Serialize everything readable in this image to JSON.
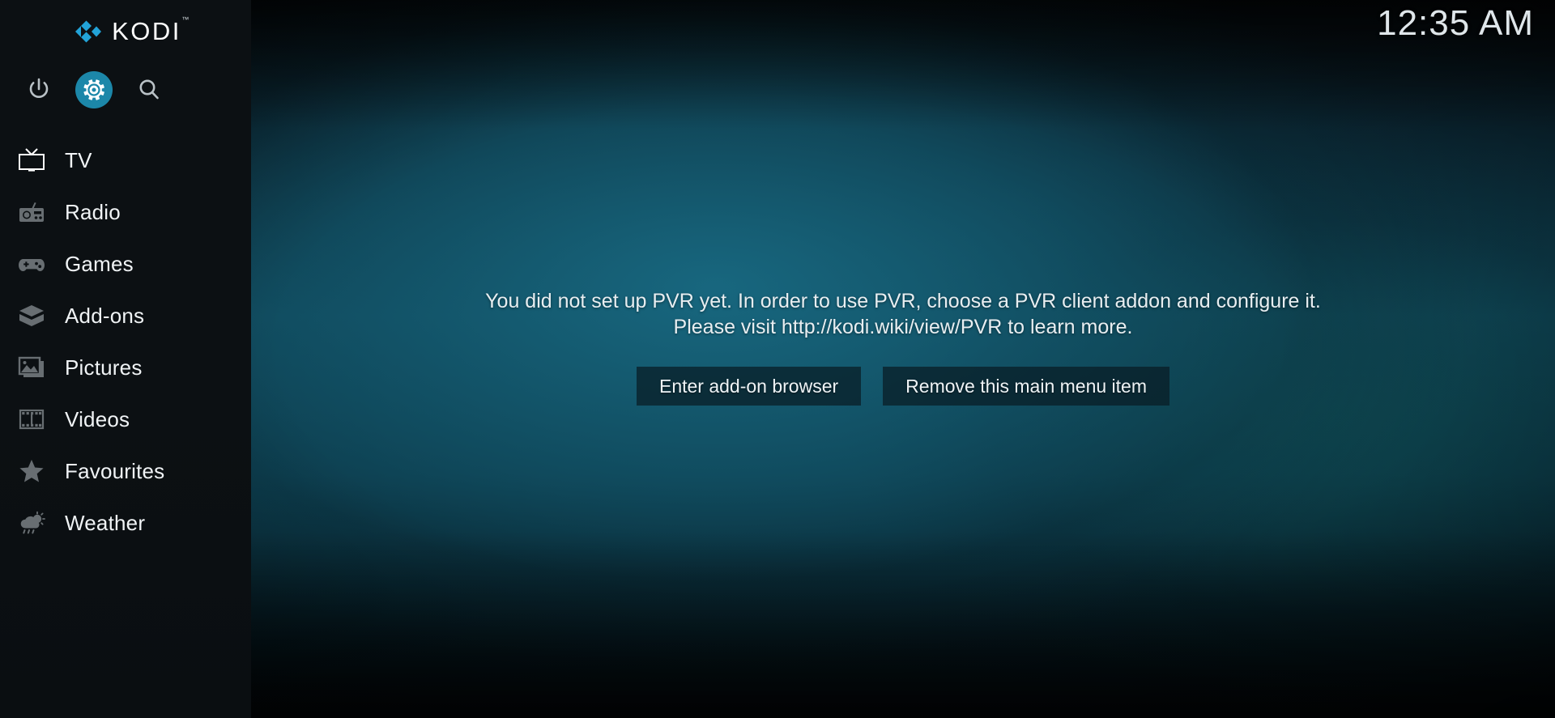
{
  "clock": {
    "time": "12:35 AM"
  },
  "brand": {
    "name": "KODI",
    "logo_icon": "kodi-logo-icon"
  },
  "quickbar": {
    "items": [
      {
        "id": "power",
        "icon": "power-icon",
        "label": "Power",
        "selected": false
      },
      {
        "id": "settings",
        "icon": "gear-icon",
        "label": "Settings",
        "selected": true
      },
      {
        "id": "search",
        "icon": "search-icon",
        "label": "Search",
        "selected": false
      }
    ]
  },
  "sidebar": {
    "items": [
      {
        "label": "TV",
        "icon": "tv-icon",
        "active": true
      },
      {
        "label": "Radio",
        "icon": "radio-icon",
        "active": false
      },
      {
        "label": "Games",
        "icon": "gamepad-icon",
        "active": false
      },
      {
        "label": "Add-ons",
        "icon": "addons-box-icon",
        "active": false
      },
      {
        "label": "Pictures",
        "icon": "picture-icon",
        "active": false
      },
      {
        "label": "Videos",
        "icon": "film-strip-icon",
        "active": false
      },
      {
        "label": "Favourites",
        "icon": "star-icon",
        "active": false
      },
      {
        "label": "Weather",
        "icon": "weather-icon",
        "active": false
      }
    ]
  },
  "main": {
    "message": "You did not set up PVR yet. In order to use PVR, choose a PVR client addon and configure it. Please visit http://kodi.wiki/view/PVR to learn more.",
    "buttons": [
      {
        "label": "Enter add-on browser"
      },
      {
        "label": "Remove this main menu item"
      }
    ]
  },
  "colors": {
    "accent": "#1c87a9",
    "logo_blue": "#22a3d8",
    "sidebar_bg": "#0c1013",
    "background_teal": "#12546a",
    "button_bg": "#081c24",
    "text_primary": "#f2f5f7"
  }
}
